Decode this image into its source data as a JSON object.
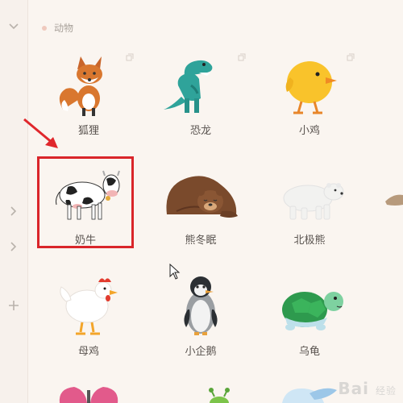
{
  "section": {
    "title": "动物"
  },
  "sidebar": {
    "icons": [
      "chevron-down-icon",
      "chevron-right-icon",
      "chevron-right-icon",
      "plus-icon"
    ]
  },
  "stickers": {
    "row1": [
      "狐狸",
      "恐龙",
      "小鸡"
    ],
    "row2": [
      "奶牛",
      "熊冬眠",
      "北极熊"
    ],
    "row3": [
      "母鸡",
      "小企鹅",
      "乌龟"
    ]
  },
  "watermark": {
    "brand": "Bai",
    "suffix": "经验"
  },
  "colors": {
    "highlight": "#d9252a",
    "arrow": "#e0272c",
    "background": "#faf5f0"
  }
}
